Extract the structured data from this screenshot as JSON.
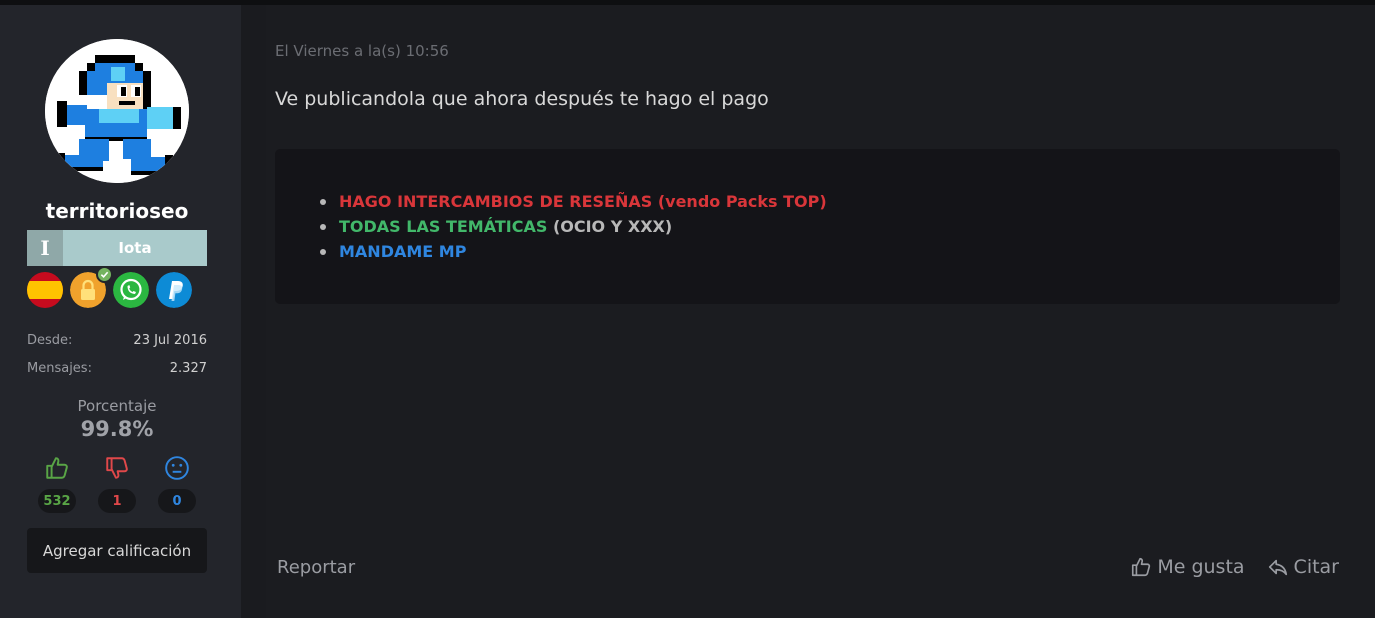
{
  "user": {
    "username": "territorioseo",
    "rank_letter": "I",
    "rank_name": "Iota",
    "badges": [
      "spain-flag-icon",
      "lock-verified-icon",
      "whatsapp-icon",
      "paypal-icon"
    ],
    "stats": [
      {
        "label": "Desde:",
        "value": "23 Jul 2016"
      },
      {
        "label": "Mensajes:",
        "value": "2.327"
      }
    ],
    "percentage_label": "Porcentaje",
    "percentage_value": "99.8%",
    "votes": {
      "positive": "532",
      "negative": "1",
      "neutral": "0"
    },
    "rate_button": "Agregar calificación"
  },
  "post": {
    "date": "El Viernes a la(s) 10:56",
    "text": "Ve publicandola que ahora después te hago el pago",
    "signature": {
      "line1": "HAGO INTERCAMBIOS DE RESEÑAS (vendo Packs TOP)",
      "line2_green": "TODAS LAS TEMÁTICAS",
      "line2_gray": " (OCIO Y XXX)",
      "line3": "MANDAME MP"
    },
    "report": "Reportar",
    "like": "Me gusta",
    "quote": "Citar"
  },
  "colors": {
    "positive": "#59a546",
    "negative": "#e0484a",
    "neutral": "#2f86e0",
    "sig_red": "#d9363a",
    "sig_green": "#42b86a",
    "sig_blue": "#2f86e0"
  }
}
